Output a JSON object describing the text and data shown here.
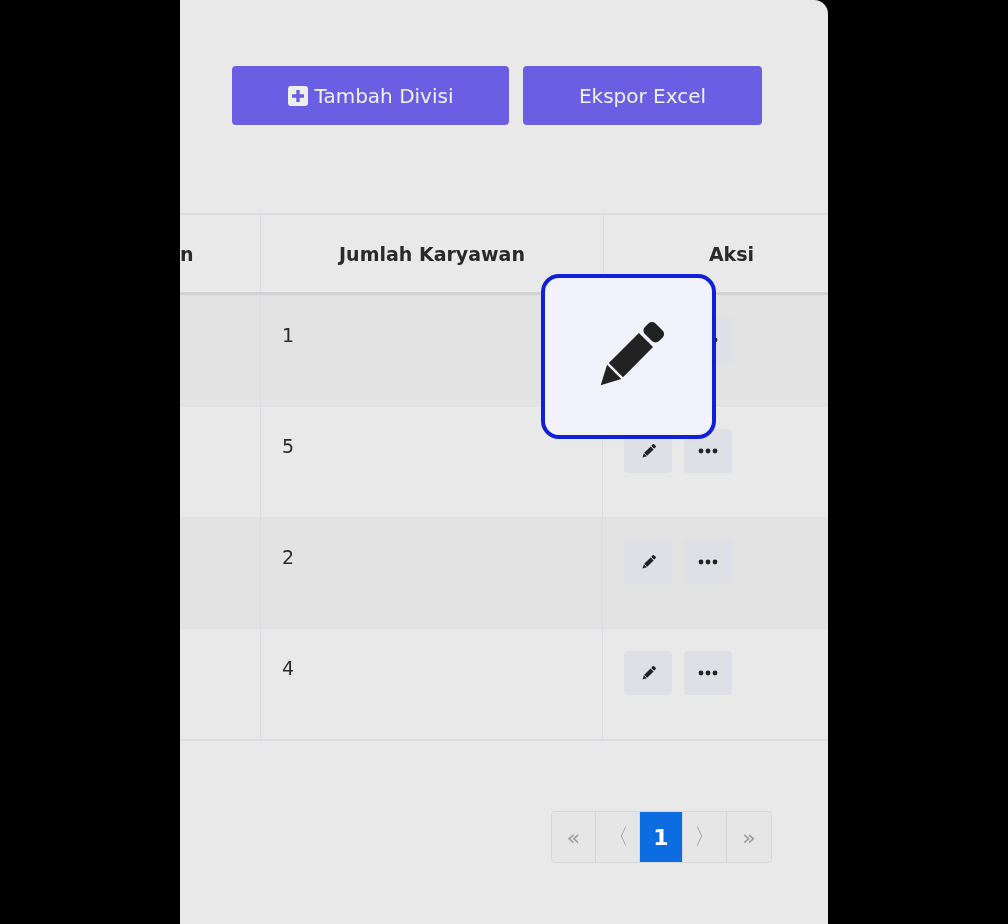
{
  "toolbar": {
    "buttons": [
      {
        "label": "Tambah Divisi",
        "kind": "add"
      },
      {
        "label": "Ekspor Excel",
        "kind": "plain"
      }
    ]
  },
  "table": {
    "columns": [
      "n",
      "Jumlah Karyawan",
      "Aksi"
    ],
    "rows": [
      {
        "count": "1"
      },
      {
        "count": "5"
      },
      {
        "count": "2"
      },
      {
        "count": "4"
      }
    ]
  },
  "pagination": [
    {
      "label": "«",
      "selected": false,
      "kind": "nav"
    },
    {
      "label": "〈",
      "selected": false,
      "kind": "nav"
    },
    {
      "label": "1",
      "selected": true,
      "kind": "page"
    },
    {
      "label": "〉",
      "selected": false,
      "kind": "nav"
    },
    {
      "label": "»",
      "selected": false,
      "kind": "nav"
    }
  ]
}
